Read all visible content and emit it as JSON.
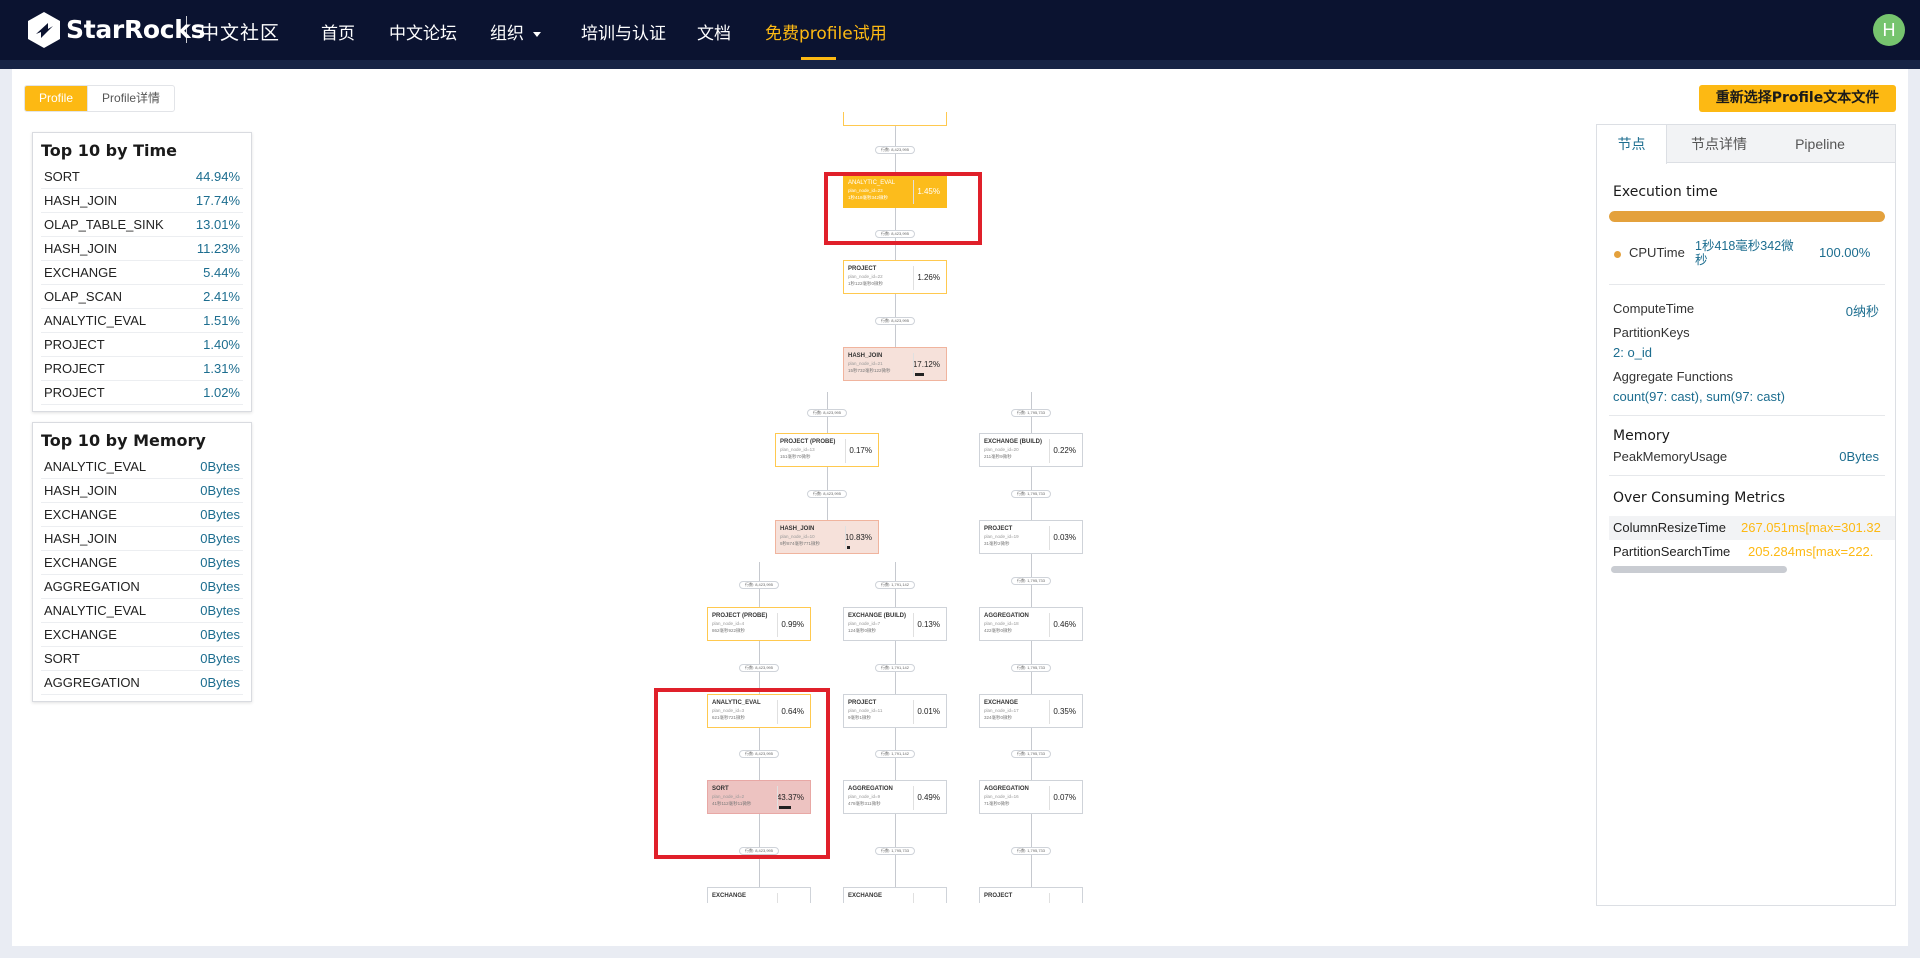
{
  "brand": {
    "name": "StarRocks",
    "community": "中文社区"
  },
  "nav": {
    "items": [
      "首页",
      "中文论坛",
      "组织",
      "培训与认证",
      "文档",
      "免费profile试用"
    ],
    "active": "免费profile试用"
  },
  "user": {
    "avatar_letter": "H"
  },
  "tabs": {
    "profile": "Profile",
    "profile_detail": "Profile详情"
  },
  "reselect_button": "重新选择Profile文本文件",
  "top_time": {
    "title": "Top 10 by Time",
    "rows": [
      {
        "name": "SORT",
        "value": "44.94%"
      },
      {
        "name": "HASH_JOIN",
        "value": "17.74%"
      },
      {
        "name": "OLAP_TABLE_SINK",
        "value": "13.01%"
      },
      {
        "name": "HASH_JOIN",
        "value": "11.23%"
      },
      {
        "name": "EXCHANGE",
        "value": "5.44%"
      },
      {
        "name": "OLAP_SCAN",
        "value": "2.41%"
      },
      {
        "name": "ANALYTIC_EVAL",
        "value": "1.51%"
      },
      {
        "name": "PROJECT",
        "value": "1.40%"
      },
      {
        "name": "PROJECT",
        "value": "1.31%"
      },
      {
        "name": "PROJECT",
        "value": "1.02%"
      }
    ]
  },
  "top_memory": {
    "title": "Top 10 by Memory",
    "rows": [
      {
        "name": "ANALYTIC_EVAL",
        "value": "0Bytes"
      },
      {
        "name": "HASH_JOIN",
        "value": "0Bytes"
      },
      {
        "name": "EXCHANGE",
        "value": "0Bytes"
      },
      {
        "name": "HASH_JOIN",
        "value": "0Bytes"
      },
      {
        "name": "EXCHANGE",
        "value": "0Bytes"
      },
      {
        "name": "AGGREGATION",
        "value": "0Bytes"
      },
      {
        "name": "ANALYTIC_EVAL",
        "value": "0Bytes"
      },
      {
        "name": "EXCHANGE",
        "value": "0Bytes"
      },
      {
        "name": "SORT",
        "value": "0Bytes"
      },
      {
        "name": "AGGREGATION",
        "value": "0Bytes"
      }
    ]
  },
  "graph": {
    "nodes": [
      {
        "name": "ANALYTIC_EVAL",
        "sub": "plan_node_id=23",
        "time": "1秒418毫秒342微秒",
        "pct": "1.45%"
      },
      {
        "name": "PROJECT",
        "sub": "plan_node_id=22",
        "time": "1秒122毫秒0微秒",
        "pct": "1.26%"
      },
      {
        "name": "HASH_JOIN",
        "sub": "plan_node_id=21",
        "time": "15秒732毫秒122微秒",
        "pct": "17.12%"
      },
      {
        "name": "PROJECT (PROBE)",
        "sub": "plan_node_id=13",
        "time": "151毫秒70微秒",
        "pct": "0.17%"
      },
      {
        "name": "EXCHANGE (BUILD)",
        "sub": "plan_node_id=20",
        "time": "211毫秒9微秒",
        "pct": "0.22%"
      },
      {
        "name": "HASH_JOIN",
        "sub": "plan_node_id=10",
        "time": "9秒874毫秒771微秒",
        "pct": "10.83%"
      },
      {
        "name": "PROJECT",
        "sub": "plan_node_id=19",
        "time": "31毫秒2微秒",
        "pct": "0.03%"
      },
      {
        "name": "PROJECT (PROBE)",
        "sub": "plan_node_id=4",
        "time": "862毫秒922微秒",
        "pct": "0.99%"
      },
      {
        "name": "EXCHANGE (BUILD)",
        "sub": "plan_node_id=7",
        "time": "124毫秒0微秒",
        "pct": "0.13%"
      },
      {
        "name": "AGGREGATION",
        "sub": "plan_node_id=18",
        "time": "422毫秒0微秒",
        "pct": "0.46%"
      },
      {
        "name": "ANALYTIC_EVAL",
        "sub": "plan_node_id=3",
        "time": "621毫秒721微秒",
        "pct": "0.64%"
      },
      {
        "name": "PROJECT",
        "sub": "plan_node_id=11",
        "time": "9毫秒1微秒",
        "pct": "0.01%"
      },
      {
        "name": "EXCHANGE",
        "sub": "plan_node_id=17",
        "time": "324毫秒0微秒",
        "pct": "0.35%"
      },
      {
        "name": "SORT",
        "sub": "plan_node_id=2",
        "time": "41秒112毫秒11微秒",
        "pct": "43.37%"
      },
      {
        "name": "AGGREGATION",
        "sub": "plan_node_id=9",
        "time": "478毫秒311微秒",
        "pct": "0.49%"
      },
      {
        "name": "AGGREGATION",
        "sub": "plan_node_id=16",
        "time": "71毫秒0微秒",
        "pct": "0.07%"
      },
      {
        "name": "EXCHANGE",
        "sub": "",
        "time": "",
        "pct": ""
      },
      {
        "name": "EXCHANGE",
        "sub": "",
        "time": "",
        "pct": ""
      },
      {
        "name": "PROJECT",
        "sub": "",
        "time": "",
        "pct": ""
      }
    ],
    "edge_labels": [
      "行数: 8,423,995",
      "行数: 1,795,733",
      "行数: 1,791,142"
    ]
  },
  "right_panel": {
    "tabs": [
      "节点",
      "节点详情",
      "Pipeline"
    ],
    "execution_time": "Execution time",
    "cpu_label": "CPUTime",
    "cpu_value": "1秒418毫秒342微秒",
    "cpu_pct": "100.00%",
    "cpu_fraction": 1.0,
    "compute_time_label": "ComputeTime",
    "compute_time_value": "0纳秒",
    "partition_keys_label": "PartitionKeys",
    "partition_keys_value": "2: o_id",
    "aggregate_label": "Aggregate Functions",
    "aggregate_value": "count(97: cast), sum(97: cast)",
    "memory_title": "Memory",
    "peak_label": "PeakMemoryUsage",
    "peak_value": "0Bytes",
    "over_title": "Over Consuming Metrics",
    "over_rows": [
      {
        "name": "ColumnResizeTime",
        "value": "267.051ms[max=301.32"
      },
      {
        "name": "PartitionSearchTime",
        "value": "205.284ms[max=222."
      }
    ]
  },
  "colors": {
    "nav_bg": "#0b1330",
    "accent": "#fdb913",
    "link": "#1c6d8f",
    "highlight_box": "#e0202a"
  }
}
